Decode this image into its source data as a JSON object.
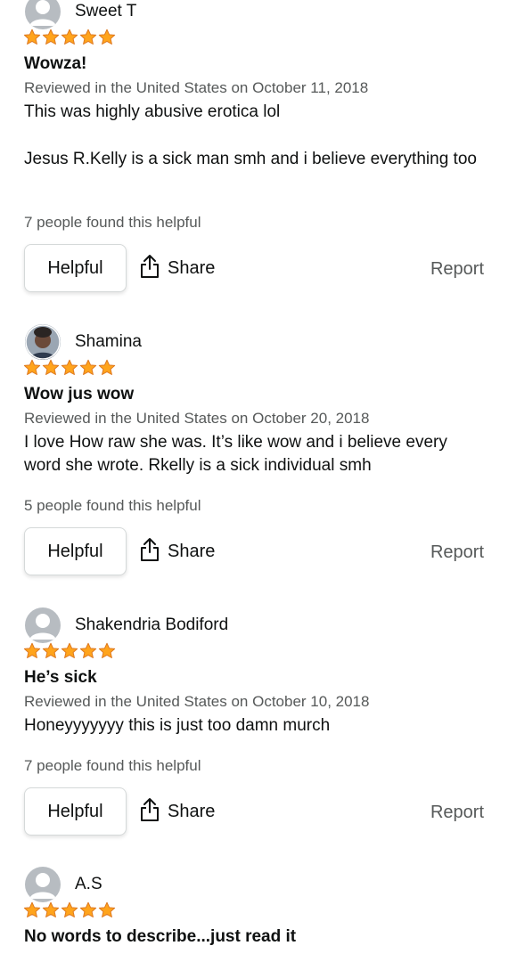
{
  "reviews": [
    {
      "author": "Sweet T",
      "avatar": "default-avatar-icon",
      "rating": 5,
      "title": "Wowza!",
      "meta": "Reviewed in the United States on October 11, 2018",
      "body": [
        "This was highly abusive erotica lol",
        "Jesus R.Kelly is a sick man smh and i believe everything too"
      ],
      "helpful_count": "7 people found this helpful",
      "helpful_label": "Helpful",
      "share_label": "Share",
      "report_label": "Report"
    },
    {
      "author": "Shamina",
      "avatar": "user-photo-avatar",
      "rating": 5,
      "title": "Wow jus wow",
      "meta": "Reviewed in the United States on October 20, 2018",
      "body": [
        "I love How raw she was. It’s like wow and i believe every word she wrote. Rkelly is a sick individual smh"
      ],
      "helpful_count": "5 people found this helpful",
      "helpful_label": "Helpful",
      "share_label": "Share",
      "report_label": "Report"
    },
    {
      "author": "Shakendria Bodiford",
      "avatar": "default-avatar-icon",
      "rating": 5,
      "title": "He’s sick",
      "meta": "Reviewed in the United States on October 10, 2018",
      "body": [
        "Honeyyyyyyy this is just too damn murch"
      ],
      "helpful_count": "7 people found this helpful",
      "helpful_label": "Helpful",
      "share_label": "Share",
      "report_label": "Report"
    },
    {
      "author": "A.S",
      "avatar": "default-avatar-icon",
      "rating": 5,
      "title": "No words to describe...just read it"
    }
  ],
  "colors": {
    "star": "#ffa41c",
    "star_stroke": "#de7921",
    "text": "#0f1111",
    "muted": "#565959",
    "avatar_bg": "#b7bcc1"
  }
}
